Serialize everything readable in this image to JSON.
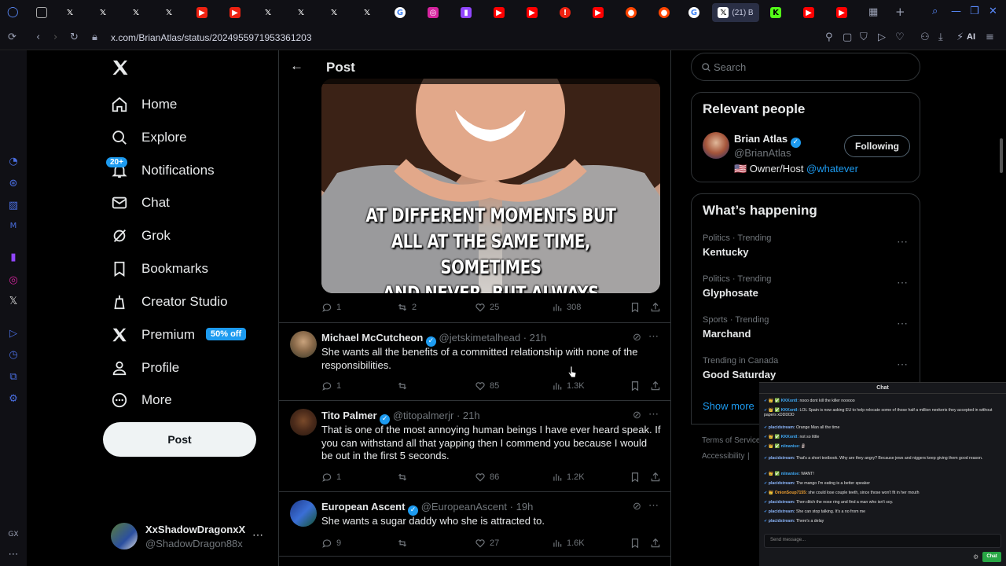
{
  "browser": {
    "active_tab_label": "(21) B",
    "url": "x.com/BrianAtlas/status/2024955971953361203",
    "ai_label": "AI"
  },
  "nav": {
    "home": "Home",
    "explore": "Explore",
    "notifications": "Notifications",
    "notifications_badge": "20+",
    "chat": "Chat",
    "grok": "Grok",
    "bookmarks": "Bookmarks",
    "creator_studio": "Creator Studio",
    "premium": "Premium",
    "premium_badge": "50% off",
    "profile": "Profile",
    "more": "More",
    "post_button": "Post",
    "account_name": "XxShadowDragonxX",
    "account_handle": "@ShadowDragon88x"
  },
  "header": {
    "title": "Post"
  },
  "meme": {
    "caption_line1": "AT DIFFERENT MOMENTS BUT",
    "caption_line2": "ALL AT THE SAME TIME, SOMETIMES",
    "caption_line3": "AND NEVER, BUT ALWAYS"
  },
  "main_post_stats": {
    "replies": "1",
    "reposts": "2",
    "likes": "25",
    "views": "308"
  },
  "replies": [
    {
      "name": "Michael McCutcheon",
      "handle": "@jetskimetalhead",
      "time": "21h",
      "text": "She wants all the benefits of a committed relationship with none of the responsibilities.",
      "replies": "1",
      "reposts": "",
      "likes": "85",
      "views": "1.3K"
    },
    {
      "name": "Tito Palmer",
      "handle": "@titopalmerjr",
      "time": "21h",
      "text": "That is one of the most annoying human beings I have ever heard speak. If you can withstand all that yapping then I commend you because I would be out in the first 5 seconds.",
      "replies": "1",
      "reposts": "",
      "likes": "86",
      "views": "1.2K"
    },
    {
      "name": "European Ascent",
      "handle": "@EuropeanAscent",
      "time": "19h",
      "text": "She wants a sugar daddy who she is attracted to.",
      "replies": "9",
      "reposts": "",
      "likes": "27",
      "views": "1.6K"
    }
  ],
  "search": {
    "placeholder": "Search"
  },
  "relevant": {
    "title": "Relevant people",
    "name": "Brian Atlas",
    "handle": "@BrianAtlas",
    "bio_prefix": "🇺🇸 Owner/Host ",
    "bio_link": "@whatever",
    "follow_button": "Following"
  },
  "happening": {
    "title": "What’s happening",
    "trends": [
      {
        "meta": "Politics · Trending",
        "title": "Kentucky"
      },
      {
        "meta": "Politics · Trending",
        "title": "Glyphosate"
      },
      {
        "meta": "Sports · Trending",
        "title": "Marchand"
      },
      {
        "meta": "Trending in Canada",
        "title": "Good Saturday"
      }
    ],
    "show_more": "Show more"
  },
  "footer": {
    "terms": "Terms of Service",
    "accessibility": "Accessibility"
  },
  "chat": {
    "title": "Chat",
    "messages": [
      {
        "user": "KKKontl:",
        "text": "nooo dont kill the killer nooooo"
      },
      {
        "user": "KKKontl:",
        "text": "LOL Spain is now asking EU to help relocate some of those half a million neekeris they accepted in without papers xDDDDD"
      },
      {
        "user": "placidstream:",
        "text": "Orange Man all the time"
      },
      {
        "user": "KKKontl:",
        "text": "not so little"
      },
      {
        "user": "niinanise:",
        "text": "🗿"
      },
      {
        "user": "placidstream:",
        "text": "That's a short textbook. Why are they angry? Because jews and niggers keep giving them good reason."
      },
      {
        "user": "niinanise:",
        "text": "WANT!"
      },
      {
        "user": "placidstream:",
        "text": "The mango I'm eating is a better speaker"
      },
      {
        "user": "OnionSoup7155:",
        "text": "she could lose couple teeth, since those won't fit in her mouth"
      },
      {
        "user": "placidstream:",
        "text": "Then ditch the nose ring and find a man who isn't soy."
      },
      {
        "user": "placidstream:",
        "text": "She can stop talking. It's a no from me"
      },
      {
        "user": "placidstream:",
        "text": "There's a delay"
      }
    ],
    "input_placeholder": "Send message...",
    "send_button": "Chat"
  },
  "colors": {
    "accent": "#1d9bf0",
    "background": "#000000",
    "border": "#2f3336",
    "muted": "#71767b"
  }
}
